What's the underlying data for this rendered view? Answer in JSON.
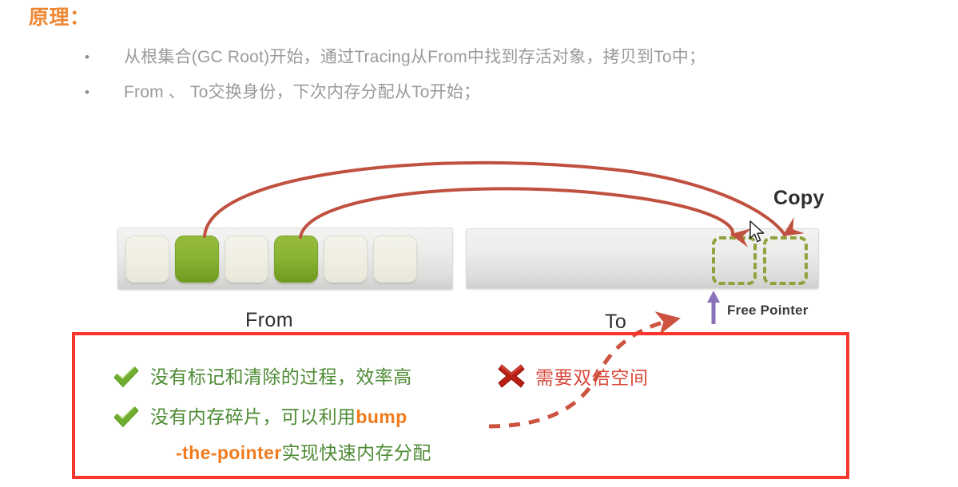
{
  "slide": {
    "title": "原理：",
    "title_color": "#ee8733"
  },
  "bullets": [
    {
      "marker": "•",
      "text": "从根集合(GC Root)开始，通过Tracing从From中找到存活对象，拷贝到To中；"
    },
    {
      "marker": "•",
      "text": "From 、 To交换身份，下次内存分配从To开始；"
    }
  ],
  "diagram": {
    "labels": {
      "copy": "Copy",
      "from": "From",
      "to": "To",
      "free_pointer": "Free Pointer"
    },
    "from_region": {
      "name": "From",
      "cells": [
        "free",
        "live",
        "free",
        "live",
        "free",
        "free"
      ]
    },
    "to_region": {
      "name": "To",
      "cells": [
        "copied",
        "copied"
      ]
    },
    "colors": {
      "live_cell": "#8ab333",
      "free_cell": "#efeee3",
      "copy_arrow": "#c0503f",
      "dashed_cell_border": "#8fa33c",
      "free_pointer_arrow": "#8a72bb",
      "dashed_red_arrow": "#cc5340"
    },
    "cursor": "mouse-pointer"
  },
  "conclusion": {
    "border_color": "#f7362e",
    "pros": [
      {
        "icon": "green-check",
        "text": "没有标记和清除的过程，效率高"
      },
      {
        "icon": "green-check",
        "text_before": "没有内存碎片，可以利用",
        "accent": "bump",
        "text_after": ""
      }
    ],
    "pro_continuation": {
      "accent": "-the-pointer",
      "text_after": "实现快速内存分配"
    },
    "con": {
      "icon": "red-x",
      "text": "需要双倍空间"
    },
    "pro_text_color": "#4e8b35",
    "accent_color": "#f07a1c",
    "con_text_color": "#d8483c"
  }
}
